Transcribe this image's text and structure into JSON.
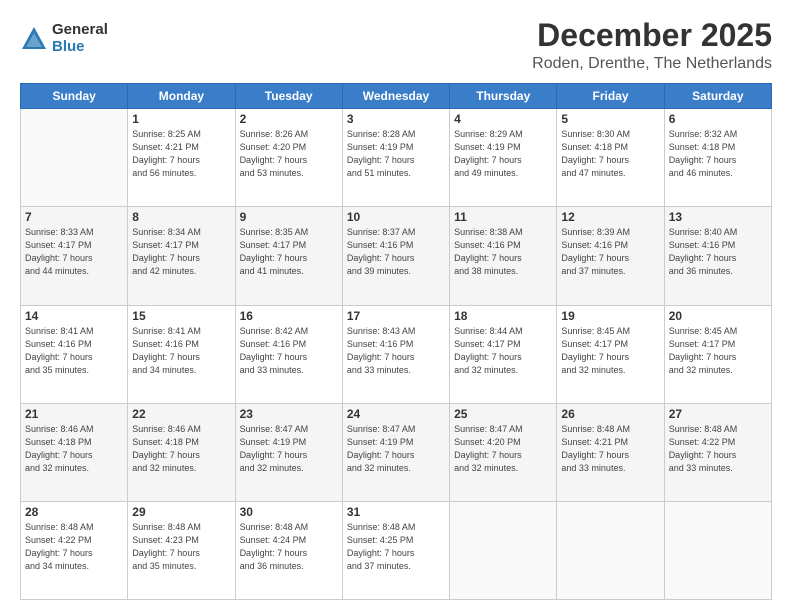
{
  "logo": {
    "general": "General",
    "blue": "Blue"
  },
  "title": {
    "month": "December 2025",
    "location": "Roden, Drenthe, The Netherlands"
  },
  "weekdays": [
    "Sunday",
    "Monday",
    "Tuesday",
    "Wednesday",
    "Thursday",
    "Friday",
    "Saturday"
  ],
  "weeks": [
    [
      {
        "day": "",
        "info": ""
      },
      {
        "day": "1",
        "info": "Sunrise: 8:25 AM\nSunset: 4:21 PM\nDaylight: 7 hours\nand 56 minutes."
      },
      {
        "day": "2",
        "info": "Sunrise: 8:26 AM\nSunset: 4:20 PM\nDaylight: 7 hours\nand 53 minutes."
      },
      {
        "day": "3",
        "info": "Sunrise: 8:28 AM\nSunset: 4:19 PM\nDaylight: 7 hours\nand 51 minutes."
      },
      {
        "day": "4",
        "info": "Sunrise: 8:29 AM\nSunset: 4:19 PM\nDaylight: 7 hours\nand 49 minutes."
      },
      {
        "day": "5",
        "info": "Sunrise: 8:30 AM\nSunset: 4:18 PM\nDaylight: 7 hours\nand 47 minutes."
      },
      {
        "day": "6",
        "info": "Sunrise: 8:32 AM\nSunset: 4:18 PM\nDaylight: 7 hours\nand 46 minutes."
      }
    ],
    [
      {
        "day": "7",
        "info": "Sunrise: 8:33 AM\nSunset: 4:17 PM\nDaylight: 7 hours\nand 44 minutes."
      },
      {
        "day": "8",
        "info": "Sunrise: 8:34 AM\nSunset: 4:17 PM\nDaylight: 7 hours\nand 42 minutes."
      },
      {
        "day": "9",
        "info": "Sunrise: 8:35 AM\nSunset: 4:17 PM\nDaylight: 7 hours\nand 41 minutes."
      },
      {
        "day": "10",
        "info": "Sunrise: 8:37 AM\nSunset: 4:16 PM\nDaylight: 7 hours\nand 39 minutes."
      },
      {
        "day": "11",
        "info": "Sunrise: 8:38 AM\nSunset: 4:16 PM\nDaylight: 7 hours\nand 38 minutes."
      },
      {
        "day": "12",
        "info": "Sunrise: 8:39 AM\nSunset: 4:16 PM\nDaylight: 7 hours\nand 37 minutes."
      },
      {
        "day": "13",
        "info": "Sunrise: 8:40 AM\nSunset: 4:16 PM\nDaylight: 7 hours\nand 36 minutes."
      }
    ],
    [
      {
        "day": "14",
        "info": "Sunrise: 8:41 AM\nSunset: 4:16 PM\nDaylight: 7 hours\nand 35 minutes."
      },
      {
        "day": "15",
        "info": "Sunrise: 8:41 AM\nSunset: 4:16 PM\nDaylight: 7 hours\nand 34 minutes."
      },
      {
        "day": "16",
        "info": "Sunrise: 8:42 AM\nSunset: 4:16 PM\nDaylight: 7 hours\nand 33 minutes."
      },
      {
        "day": "17",
        "info": "Sunrise: 8:43 AM\nSunset: 4:16 PM\nDaylight: 7 hours\nand 33 minutes."
      },
      {
        "day": "18",
        "info": "Sunrise: 8:44 AM\nSunset: 4:17 PM\nDaylight: 7 hours\nand 32 minutes."
      },
      {
        "day": "19",
        "info": "Sunrise: 8:45 AM\nSunset: 4:17 PM\nDaylight: 7 hours\nand 32 minutes."
      },
      {
        "day": "20",
        "info": "Sunrise: 8:45 AM\nSunset: 4:17 PM\nDaylight: 7 hours\nand 32 minutes."
      }
    ],
    [
      {
        "day": "21",
        "info": "Sunrise: 8:46 AM\nSunset: 4:18 PM\nDaylight: 7 hours\nand 32 minutes."
      },
      {
        "day": "22",
        "info": "Sunrise: 8:46 AM\nSunset: 4:18 PM\nDaylight: 7 hours\nand 32 minutes."
      },
      {
        "day": "23",
        "info": "Sunrise: 8:47 AM\nSunset: 4:19 PM\nDaylight: 7 hours\nand 32 minutes."
      },
      {
        "day": "24",
        "info": "Sunrise: 8:47 AM\nSunset: 4:19 PM\nDaylight: 7 hours\nand 32 minutes."
      },
      {
        "day": "25",
        "info": "Sunrise: 8:47 AM\nSunset: 4:20 PM\nDaylight: 7 hours\nand 32 minutes."
      },
      {
        "day": "26",
        "info": "Sunrise: 8:48 AM\nSunset: 4:21 PM\nDaylight: 7 hours\nand 33 minutes."
      },
      {
        "day": "27",
        "info": "Sunrise: 8:48 AM\nSunset: 4:22 PM\nDaylight: 7 hours\nand 33 minutes."
      }
    ],
    [
      {
        "day": "28",
        "info": "Sunrise: 8:48 AM\nSunset: 4:22 PM\nDaylight: 7 hours\nand 34 minutes."
      },
      {
        "day": "29",
        "info": "Sunrise: 8:48 AM\nSunset: 4:23 PM\nDaylight: 7 hours\nand 35 minutes."
      },
      {
        "day": "30",
        "info": "Sunrise: 8:48 AM\nSunset: 4:24 PM\nDaylight: 7 hours\nand 36 minutes."
      },
      {
        "day": "31",
        "info": "Sunrise: 8:48 AM\nSunset: 4:25 PM\nDaylight: 7 hours\nand 37 minutes."
      },
      {
        "day": "",
        "info": ""
      },
      {
        "day": "",
        "info": ""
      },
      {
        "day": "",
        "info": ""
      }
    ]
  ]
}
